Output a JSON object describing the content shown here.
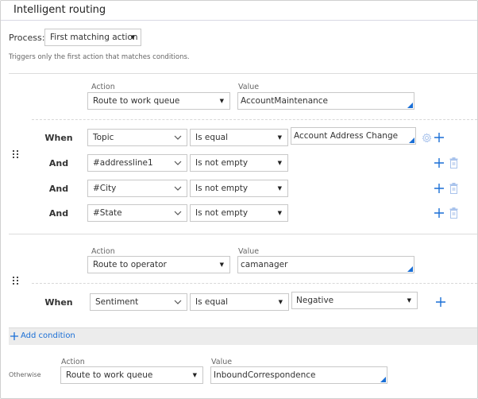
{
  "header": {
    "title": "Intelligent routing"
  },
  "process": {
    "label": "Process:",
    "value": "First matching action",
    "hint": "Triggers only the first action that matches conditions."
  },
  "rules": [
    {
      "action_label": "Action",
      "action_value": "Route to work queue",
      "value_label": "Value",
      "value_value": "AccountMaintenance",
      "conditions": [
        {
          "connector": "When",
          "field": "Topic",
          "operator": "Is equal",
          "value": "Account Address Change"
        },
        {
          "connector": "And",
          "field": "#addressline1",
          "operator": "Is not empty"
        },
        {
          "connector": "And",
          "field": "#City",
          "operator": "Is not empty"
        },
        {
          "connector": "And",
          "field": "#State",
          "operator": "Is not empty"
        }
      ]
    },
    {
      "action_label": "Action",
      "action_value": "Route to operator",
      "value_label": "Value",
      "value_value": "camanager",
      "conditions": [
        {
          "connector": "When",
          "field": "Sentiment",
          "operator": "Is equal",
          "value": "Negative"
        }
      ]
    }
  ],
  "add_condition": {
    "label": "Add condition"
  },
  "otherwise": {
    "label": "Otherwise",
    "action_label": "Action",
    "action_value": "Route to work queue",
    "value_label": "Value",
    "value_value": "InboundCorrespondence"
  },
  "colors": {
    "accent": "#1a6fd6",
    "icon_muted": "#a9c3ec",
    "bar": "#ececec"
  }
}
